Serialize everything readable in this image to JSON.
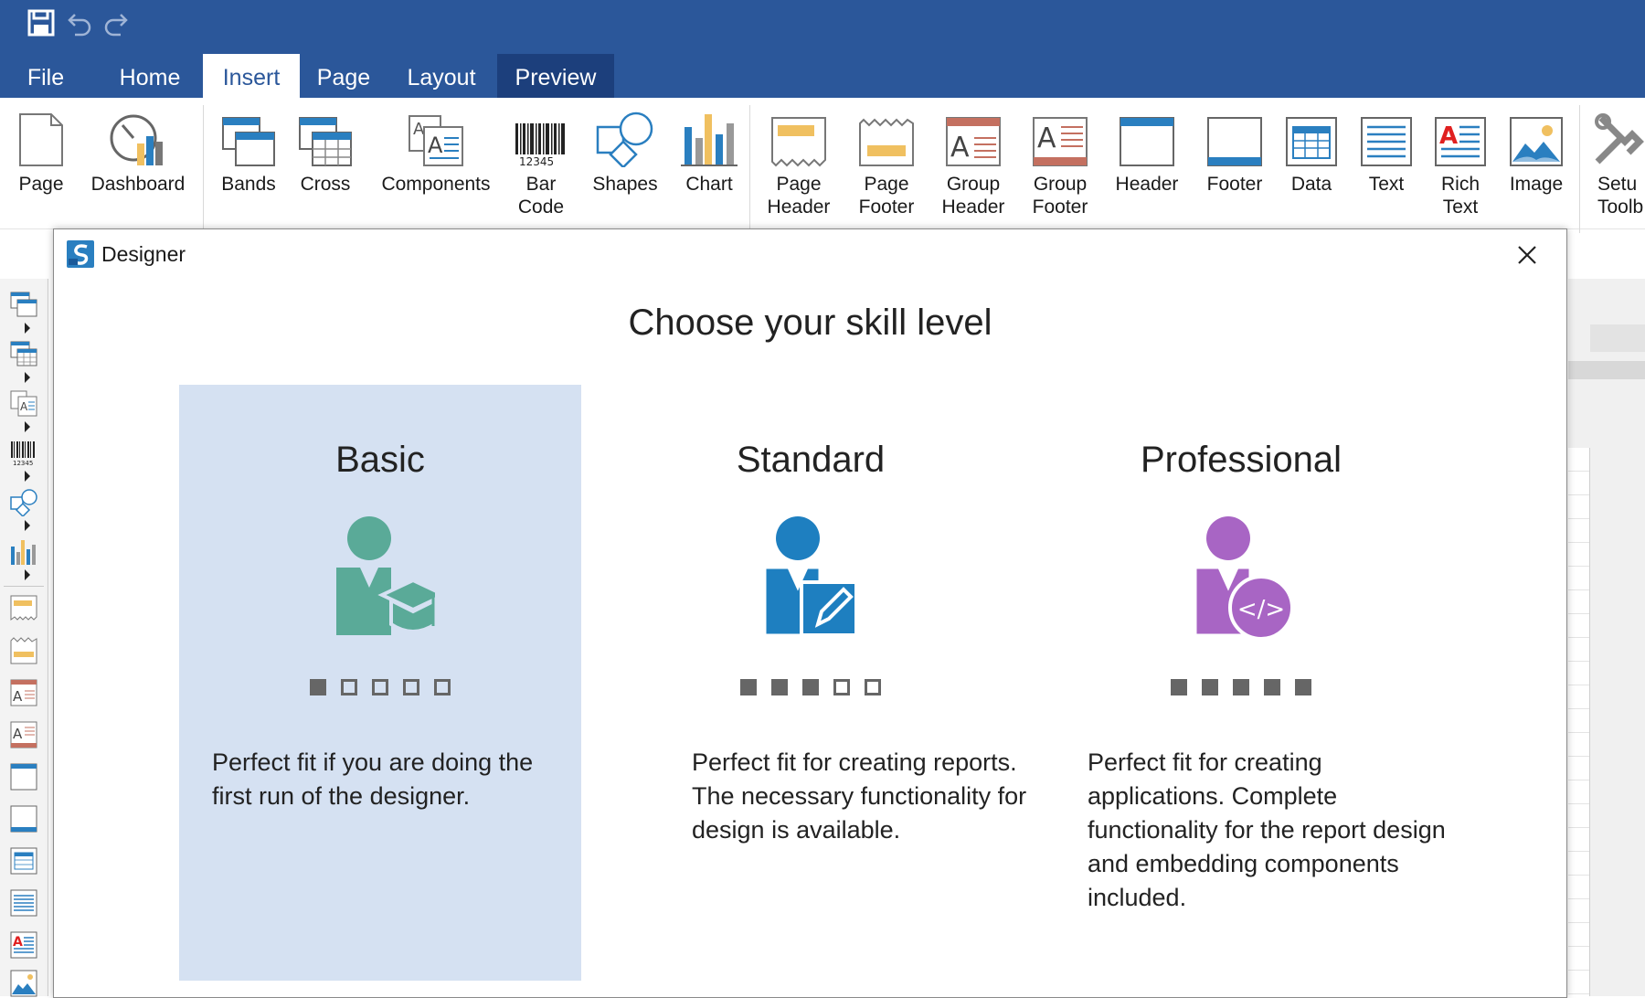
{
  "tabs": [
    {
      "label": "File"
    },
    {
      "label": "Home"
    },
    {
      "label": "Insert"
    },
    {
      "label": "Page"
    },
    {
      "label": "Layout"
    },
    {
      "label": "Preview"
    }
  ],
  "ribbon": {
    "page": "Page",
    "dashboard": "Dashboard",
    "bands": "Bands",
    "cross": "Cross",
    "components": "Components",
    "bar_code_1": "Bar",
    "bar_code_2": "Code",
    "shapes": "Shapes",
    "chart": "Chart",
    "page_header_1": "Page",
    "page_header_2": "Header",
    "page_footer_1": "Page",
    "page_footer_2": "Footer",
    "group_header_1": "Group",
    "group_header_2": "Header",
    "group_footer_1": "Group",
    "group_footer_2": "Footer",
    "header": "Header",
    "footer": "Footer",
    "data": "Data",
    "text": "Text",
    "rich_text_1": "Rich",
    "rich_text_2": "Text",
    "image": "Image",
    "setup_1": "Setu",
    "setup_2": "Toolb"
  },
  "dialog": {
    "title": "Designer",
    "heading": "Choose your skill level",
    "cards": [
      {
        "title": "Basic",
        "level": 1,
        "max_level": 5,
        "selected": true,
        "description": "Perfect fit if you are doing the first run of the designer."
      },
      {
        "title": "Standard",
        "level": 3,
        "max_level": 5,
        "selected": false,
        "description": "Perfect fit for creating reports. The necessary functionality for design is available."
      },
      {
        "title": "Professional",
        "level": 5,
        "max_level": 5,
        "selected": false,
        "description": "Perfect fit for creating applications. Complete functionality for the report design and embedding components included."
      }
    ]
  },
  "colors": {
    "accent": "#2b579a",
    "basic": "#5aaa98",
    "standard": "#1e7fc0",
    "professional": "#a865c4",
    "selected_card": "#d5e1f2"
  }
}
